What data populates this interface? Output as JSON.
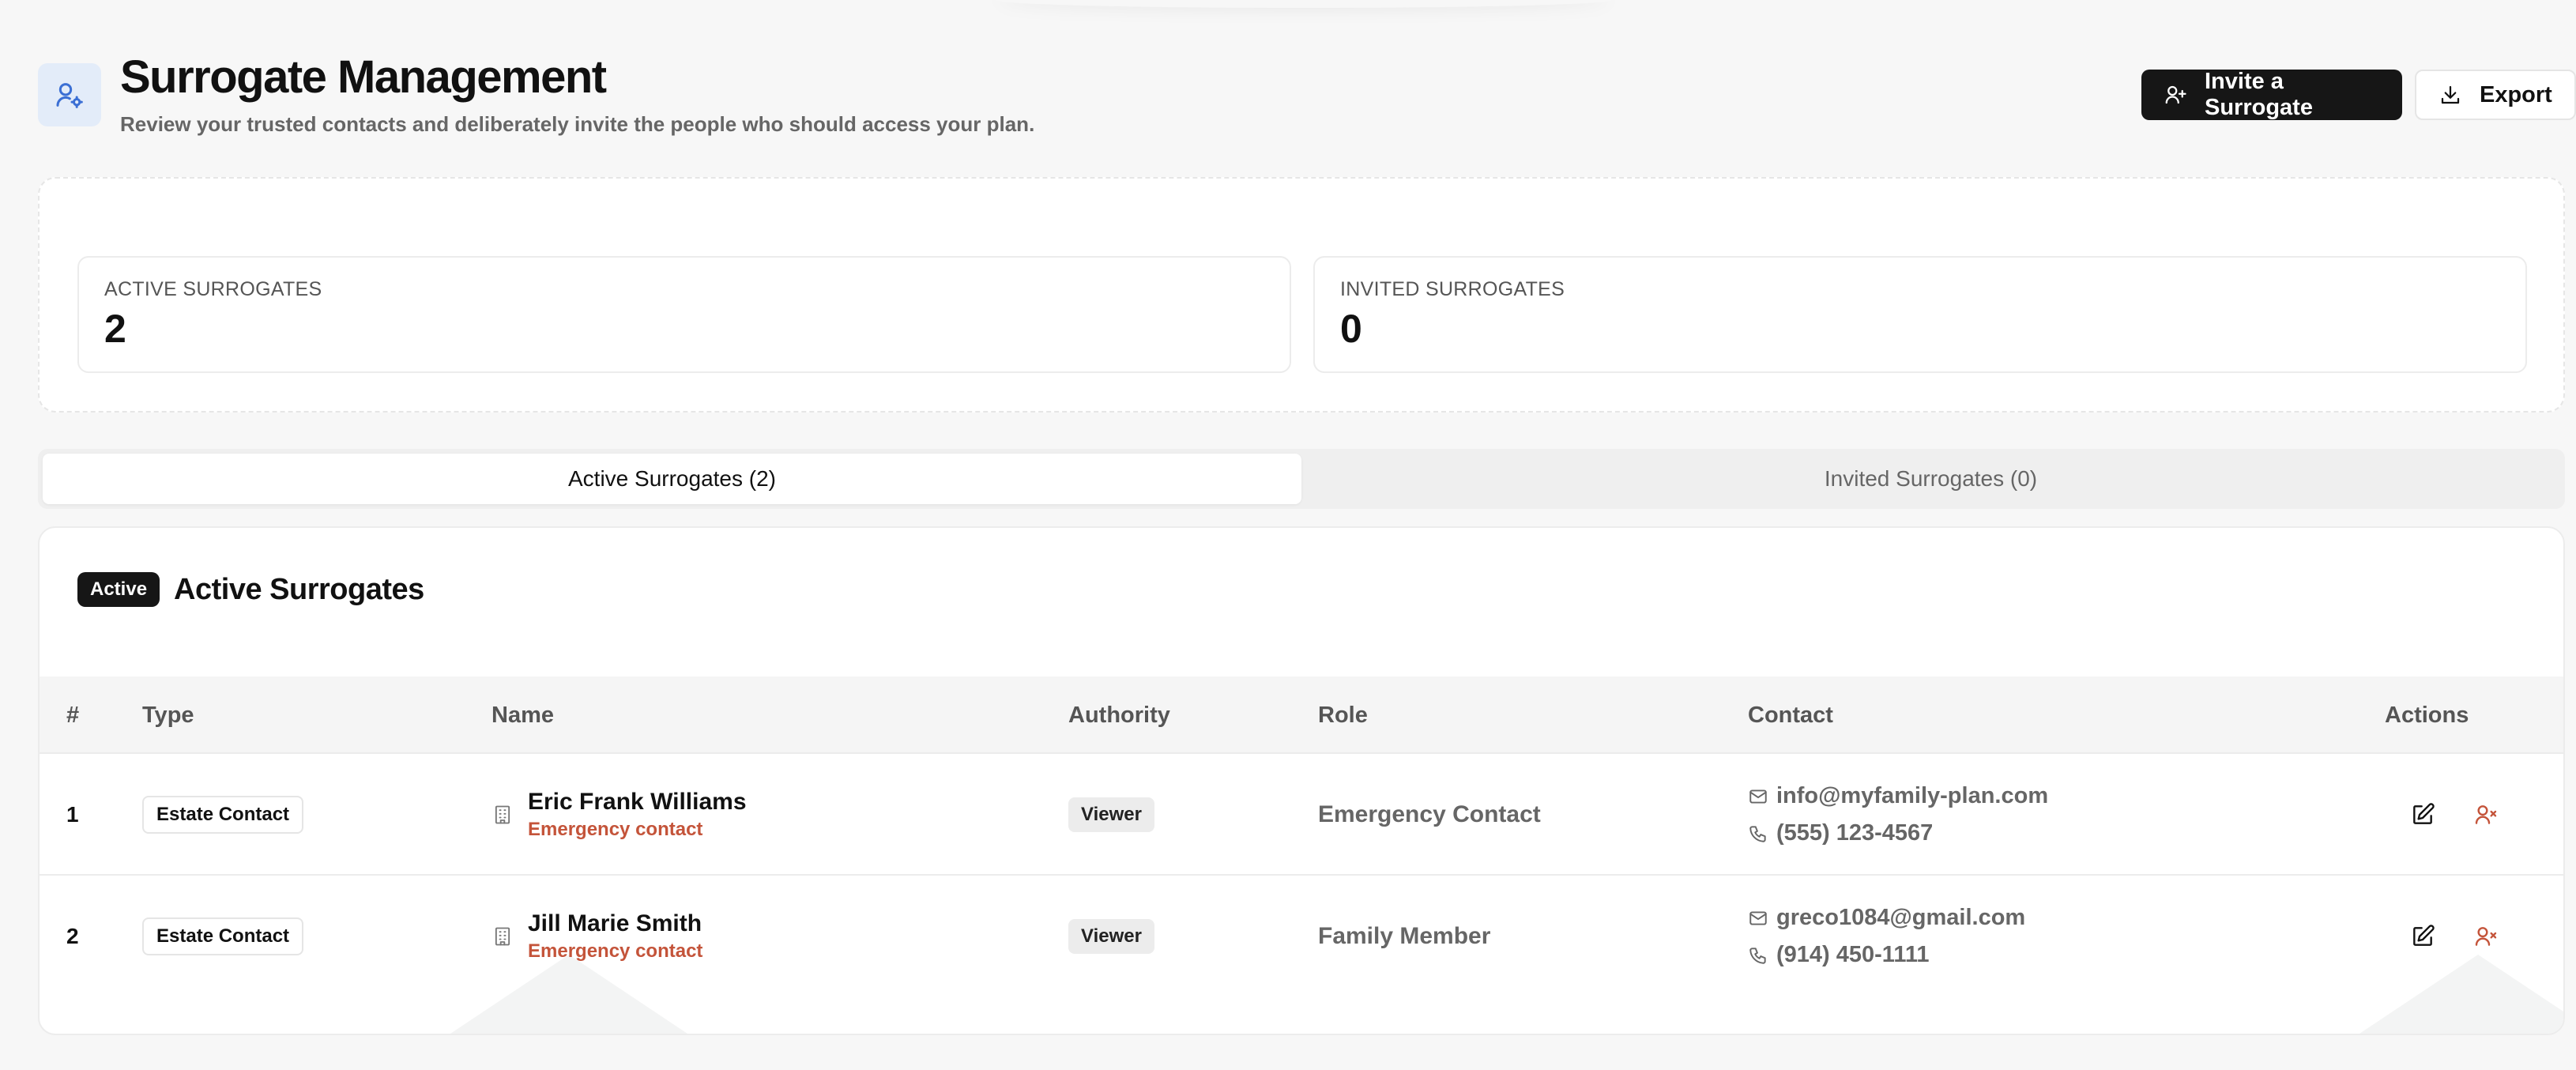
{
  "header": {
    "title": "Surrogate Management",
    "subtitle": "Review your trusted contacts and deliberately invite the people who should access your plan.",
    "icon": "user-settings-icon",
    "invite_label": "Invite a Surrogate",
    "export_label": "Export"
  },
  "stats": [
    {
      "label": "ACTIVE SURROGATES",
      "value": "2"
    },
    {
      "label": "INVITED SURROGATES",
      "value": "0"
    }
  ],
  "tabs": [
    {
      "label": "Active Surrogates (2)",
      "active": true
    },
    {
      "label": "Invited Surrogates (0)",
      "active": false
    }
  ],
  "card": {
    "badge": "Active",
    "title": "Active Surrogates"
  },
  "table": {
    "columns": [
      "#",
      "Type",
      "Name",
      "Authority",
      "Role",
      "Contact",
      "Actions"
    ],
    "rows": [
      {
        "index": "1",
        "type": "Estate Contact",
        "name": "Eric Frank Williams",
        "subtitle": "Emergency contact",
        "authority": "Viewer",
        "role": "Emergency Contact",
        "email": "info@myfamily-plan.com",
        "phone": "(555) 123-4567"
      },
      {
        "index": "2",
        "type": "Estate Contact",
        "name": "Jill Marie Smith",
        "subtitle": "Emergency contact",
        "authority": "Viewer",
        "role": "Family Member",
        "email": "greco1084@gmail.com",
        "phone": "(914) 450-1111"
      }
    ]
  },
  "colors": {
    "primary": "#161616",
    "accent_red": "#c4543a",
    "icon_bg": "#e3ecf9",
    "icon_blue": "#3b6fd4"
  }
}
